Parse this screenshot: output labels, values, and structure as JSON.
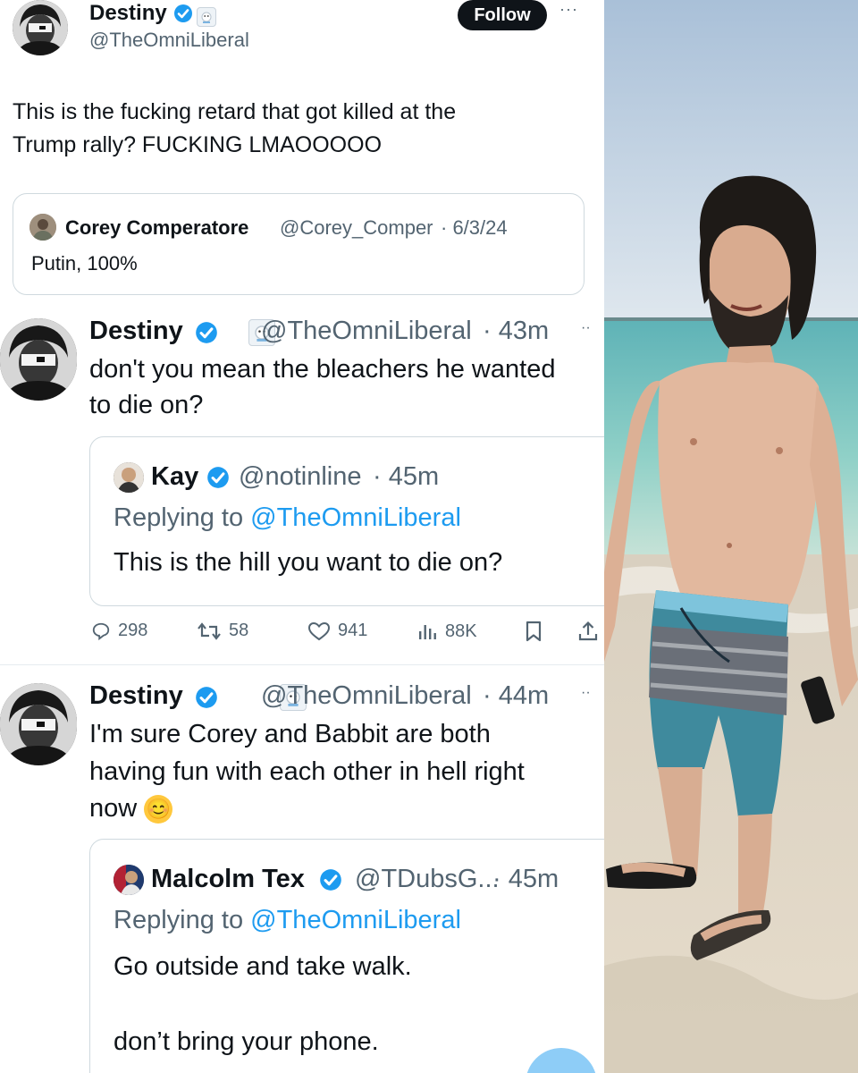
{
  "main_tweet": {
    "author_name": "Destiny",
    "author_handle": "@TheOmniLiberal",
    "follow_label": "Follow",
    "more_label": "···",
    "text_line1": "This is the fucking retard that got killed at the",
    "text_line2": "Trump rally? FUCKING LMAOOOOO",
    "quote": {
      "author_name": "Corey Comperatore",
      "author_handle": "@Corey_Comper",
      "date": "· 6/3/24",
      "text": "Putin, 100%"
    }
  },
  "reply1": {
    "author_name": "Destiny",
    "author_handle": "@TheOmniLiberal",
    "time": "· 43m",
    "more_label": "··",
    "text_line1": "don't you mean the bleachers he wanted",
    "text_line2": "to die on?",
    "quote": {
      "author_name": "Kay",
      "author_handle": "@notinline",
      "time": "· 45m",
      "replying_prefix": "Replying to ",
      "replying_handle": "@TheOmniLiberal",
      "text": "This is the hill you want to die on?"
    },
    "stats": {
      "replies": "298",
      "retweets": "58",
      "likes": "941",
      "views": "88K"
    }
  },
  "reply2": {
    "author_name": "Destiny",
    "author_handle": "@TheOmniLiberal",
    "time": "· 44m",
    "more_label": "··",
    "text_line1": "I'm sure Corey and Babbit are both",
    "text_line2": "having fun with each other in hell right",
    "text_line3": "now",
    "emoji": "😊",
    "quote": {
      "author_name": "Malcolm Tex",
      "author_handle": "@TDubsG...",
      "time": "· 45m",
      "replying_prefix": "Replying to ",
      "replying_handle": "@TheOmniLiberal",
      "text_line1": "Go outside and take walk.",
      "text_line2": "don’t bring your phone."
    }
  },
  "colors": {
    "accent": "#1d9bf0",
    "text": "#0f1419",
    "muted": "#536471",
    "border": "#cfd9de"
  },
  "icons": [
    "verified-badge-icon",
    "reply-icon",
    "retweet-icon",
    "like-icon",
    "views-icon",
    "bookmark-icon",
    "share-icon"
  ]
}
